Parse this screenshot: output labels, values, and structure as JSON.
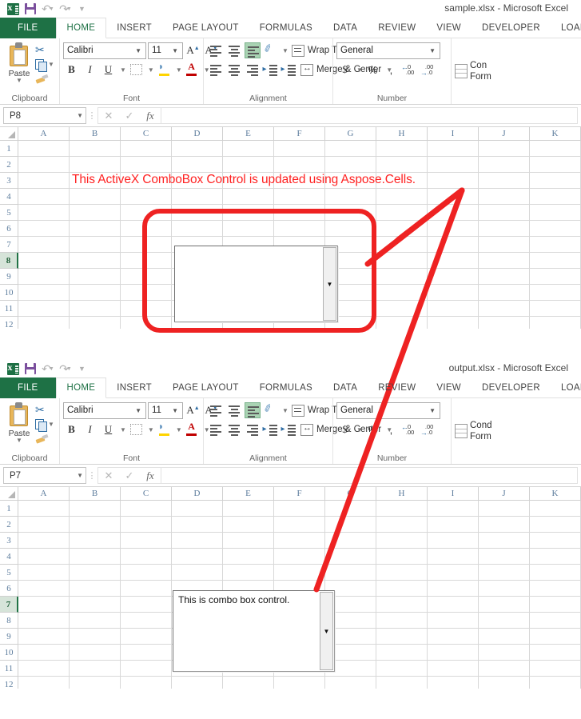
{
  "windows": [
    {
      "id": "sample",
      "title": "sample.xlsx - Microsoft Excel",
      "quick_access": [
        "excel-logo",
        "save-icon",
        "undo-icon",
        "redo-icon",
        "customize-qat-icon"
      ],
      "tabs": [
        "FILE",
        "HOME",
        "INSERT",
        "PAGE LAYOUT",
        "FORMULAS",
        "DATA",
        "REVIEW",
        "VIEW",
        "DEVELOPER",
        "LOAD TE"
      ],
      "active_tab": "HOME",
      "ribbon": {
        "clipboard": {
          "label": "Clipboard",
          "paste": "Paste",
          "cut": "cut-icon",
          "copy": "copy-icon",
          "format_painter": "format-painter-icon"
        },
        "font": {
          "label": "Font",
          "font_name": "Calibri",
          "font_size": "11",
          "bold": "B",
          "italic": "I",
          "underline": "U"
        },
        "alignment": {
          "label": "Alignment",
          "wrap_text": "Wrap Text",
          "merge_center": "Merge & Center"
        },
        "number": {
          "label": "Number",
          "format": "General",
          "currency": "$",
          "percent": "%",
          "comma": ","
        },
        "styles": {
          "conditional": "Con",
          "formatting": "Form"
        }
      },
      "formula_bar": {
        "name_box": "P8",
        "cancel": "✕",
        "enter": "✓",
        "insert_function": "fx",
        "formula": ""
      },
      "grid": {
        "columns": [
          "A",
          "B",
          "C",
          "D",
          "E",
          "F",
          "G",
          "H",
          "I",
          "J",
          "K"
        ],
        "rows": [
          "1",
          "2",
          "3",
          "4",
          "5",
          "6",
          "7",
          "8",
          "9",
          "10",
          "11",
          "12"
        ],
        "selected_row": "8"
      },
      "annotation_text": "This ActiveX ComboBox Control is updated using Aspose.Cells.",
      "combobox": {
        "value": "",
        "dropdown": "chevron-down-icon"
      }
    },
    {
      "id": "output",
      "title": "output.xlsx - Microsoft Excel",
      "quick_access": [
        "excel-logo",
        "save-icon",
        "undo-icon",
        "redo-icon",
        "customize-qat-icon"
      ],
      "tabs": [
        "FILE",
        "HOME",
        "INSERT",
        "PAGE LAYOUT",
        "FORMULAS",
        "DATA",
        "REVIEW",
        "VIEW",
        "DEVELOPER",
        "LOAD TES"
      ],
      "active_tab": "HOME",
      "ribbon": {
        "clipboard": {
          "label": "Clipboard",
          "paste": "Paste",
          "cut": "cut-icon",
          "copy": "copy-icon",
          "format_painter": "format-painter-icon"
        },
        "font": {
          "label": "Font",
          "font_name": "Calibri",
          "font_size": "11",
          "bold": "B",
          "italic": "I",
          "underline": "U"
        },
        "alignment": {
          "label": "Alignment",
          "wrap_text": "Wrap Text",
          "merge_center": "Merge & Center"
        },
        "number": {
          "label": "Number",
          "format": "General",
          "currency": "$",
          "percent": "%",
          "comma": ","
        },
        "styles": {
          "conditional": "Cond",
          "formatting": "Form"
        }
      },
      "formula_bar": {
        "name_box": "P7",
        "cancel": "✕",
        "enter": "✓",
        "insert_function": "fx",
        "formula": ""
      },
      "grid": {
        "columns": [
          "A",
          "B",
          "C",
          "D",
          "E",
          "F",
          "G",
          "H",
          "I",
          "J",
          "K"
        ],
        "rows": [
          "1",
          "2",
          "3",
          "4",
          "5",
          "6",
          "7",
          "8",
          "9",
          "10",
          "11",
          "12"
        ],
        "selected_row": "7"
      },
      "combobox": {
        "value": "This is combo box control.",
        "dropdown": "chevron-down-icon"
      }
    }
  ],
  "colors": {
    "accent_green": "#1e7145",
    "annotation_red": "#ff2222",
    "callout_red": "#ee2222",
    "selected_row_bg": "#d6e4d9"
  }
}
